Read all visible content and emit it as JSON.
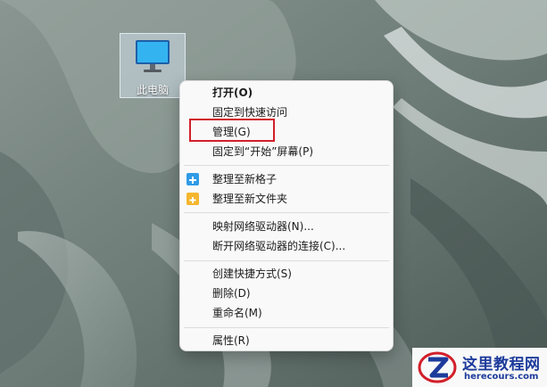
{
  "desktop": {
    "icon_label": "此电脑"
  },
  "context_menu": {
    "items": [
      {
        "label": "打开(O)"
      },
      {
        "label": "固定到快速访问"
      },
      {
        "label": "管理(G)"
      },
      {
        "label": "固定到“开始”屏幕(P)"
      },
      {
        "label": "整理至新格子"
      },
      {
        "label": "整理至新文件夹"
      },
      {
        "label": "映射网络驱动器(N)..."
      },
      {
        "label": "断开网络驱动器的连接(C)..."
      },
      {
        "label": "创建快捷方式(S)"
      },
      {
        "label": "删除(D)"
      },
      {
        "label": "重命名(M)"
      },
      {
        "label": "属性(R)"
      }
    ]
  },
  "colors": {
    "highlight_box": "#d21f2a",
    "new_box_icon": "#2f9be6",
    "new_folder_icon": "#f5b62e"
  },
  "watermark": {
    "title": "这里教程网",
    "url": "herecours.com"
  }
}
